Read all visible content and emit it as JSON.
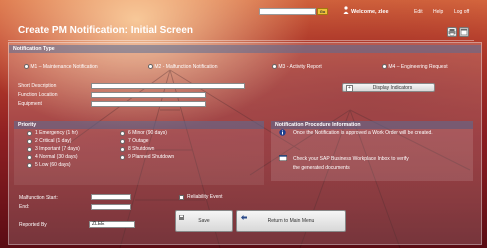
{
  "header": {
    "go_label": "Go",
    "welcome": "Welcome, zlee",
    "nav": [
      "Edit",
      "Help",
      "Log off"
    ]
  },
  "title": "Create PM Notification: Initial Screen",
  "notification_type": {
    "heading": "Notification Type",
    "options": [
      "M1 – Maintenance Notification",
      "M2 - Malfunction Notification",
      "M3 - Activity Report",
      "M4 – Engineering Request"
    ]
  },
  "fields": {
    "short_description": "Short Description",
    "function_location": "Function Location",
    "equipment": "Equipment",
    "display_indicators": "Display Indicators"
  },
  "priority": {
    "heading": "Priority",
    "left": [
      "1 Emergency (1 hr)",
      "2 Critical (1 day)",
      "3 Important (7 days)",
      "4 Normal (30 days)",
      "5 Low (60 days)"
    ],
    "right": [
      "6 Minor (90 days)",
      "7 Outage",
      "8 Shutdown",
      "9 Planned Shutdown"
    ]
  },
  "info": {
    "heading": "Notification Procedure Information",
    "line1": "Once the Notification is approved a Work Order will be created.",
    "line2": "Check your SAP Business Workplace Inbox to verify",
    "line3": "the generated documents"
  },
  "bottom": {
    "malfunction_start": "Malfunction Start:",
    "end": "End:",
    "reliability_event": "Reliability Event",
    "reported_by": "Reported By",
    "reported_by_value": "ZLEE",
    "save": "Save",
    "return": "Return to Main Menu"
  },
  "colors": {
    "section_header": "#5a6e96",
    "go_button": "#f0c23a"
  }
}
